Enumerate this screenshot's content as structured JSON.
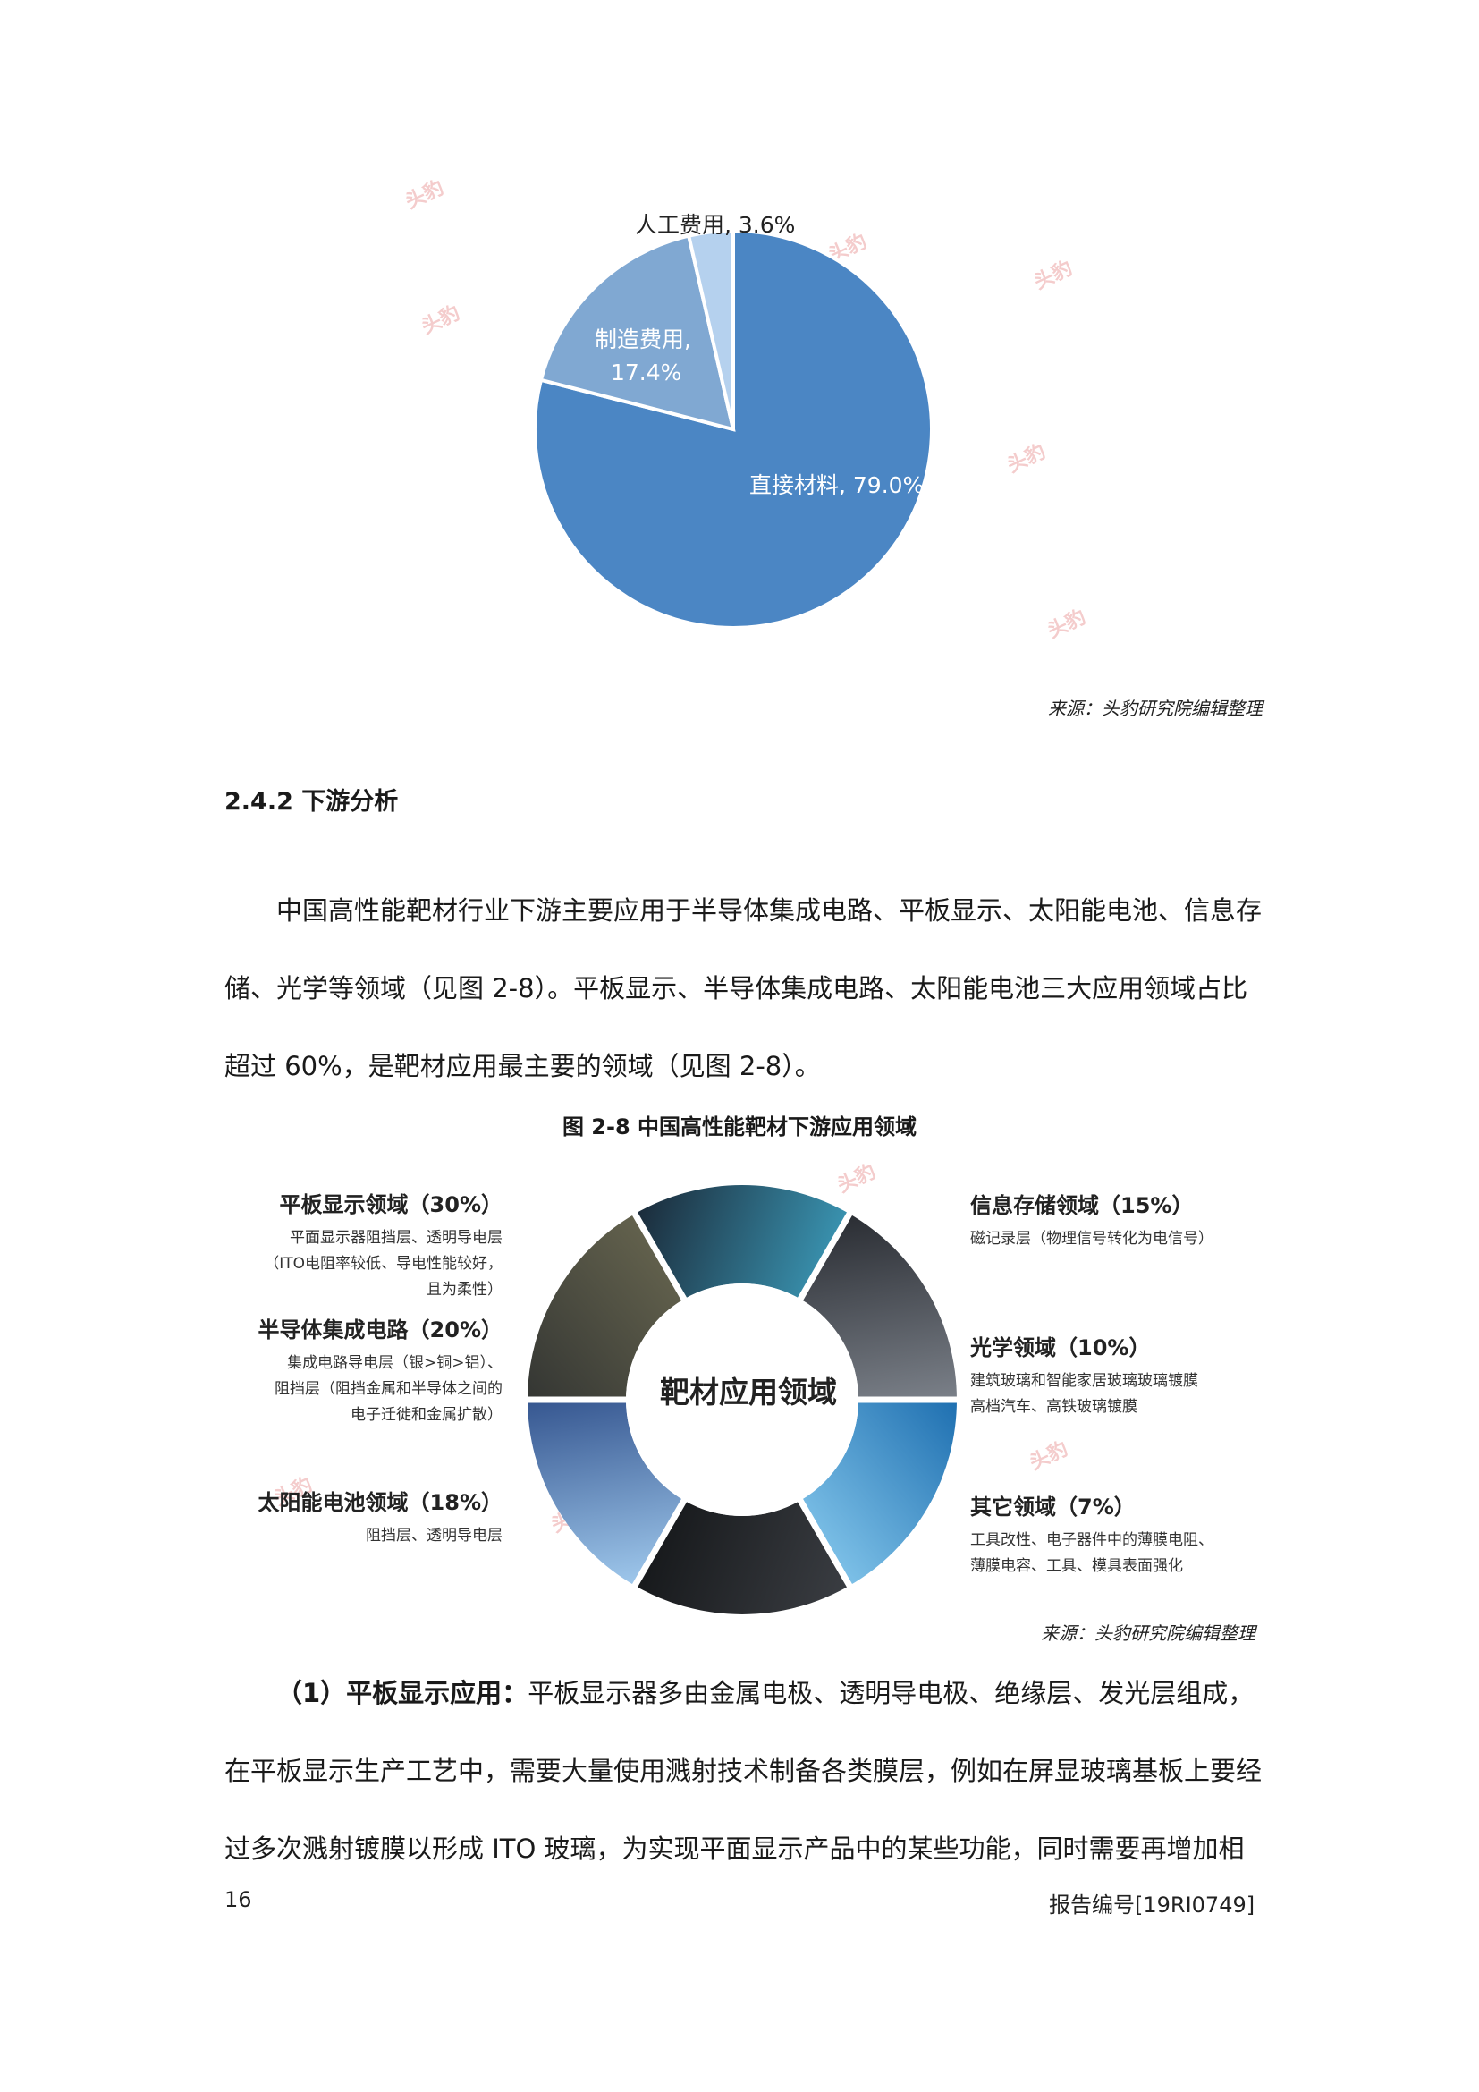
{
  "chart_data": {
    "type": "pie",
    "labels": [
      "直接材料",
      "制造费用",
      "人工费用"
    ],
    "values": [
      79.0,
      17.4,
      3.6
    ],
    "label_texts": [
      "直接材料, 79.0%",
      "制造费用,",
      "17.4%",
      "人工费用, 3.6%"
    ],
    "colors": [
      "#4b86c4",
      "#80a8d2",
      "#b5d1ee"
    ]
  },
  "figure1_source": "来源：头豹研究院编辑整理",
  "section_heading": "2.4.2 下游分析",
  "paragraph1": [
    "中国高性能靶材行业下游主要应用于半导体集成电路、平板显示、太阳能电池、信息存",
    "储、光学等领域（见图 2-8）。平板显示、半导体集成电路、太阳能电池三大应用领域占比",
    "超过 60%，是靶材应用最主要的领域（见图 2-8）。"
  ],
  "figure2": {
    "caption": "图 2-8  中国高性能靶材下游应用领域",
    "center": "靶材应用领域",
    "segments": [
      {
        "title": "平板显示领域（30%）",
        "lines": [
          "平面显示器阻挡层、透明导电层",
          "（ITO电阻率较低、导电性能较好，",
          "且为柔性）"
        ]
      },
      {
        "title": "半导体集成电路（20%）",
        "lines": [
          "集成电路导电层（银>铜>铝）、",
          "阻挡层（阻挡金属和半导体之间的",
          "电子迁徙和金属扩散）"
        ]
      },
      {
        "title": "太阳能电池领域（18%）",
        "lines": [
          "阻挡层、透明导电层"
        ]
      },
      {
        "title": "信息存储领域（15%）",
        "lines": [
          "磁记录层（物理信号转化为电信号）"
        ]
      },
      {
        "title": "光学领域（10%）",
        "lines": [
          "建筑玻璃和智能家居玻璃玻璃镀膜",
          "高档汽车、高铁玻璃镀膜"
        ]
      },
      {
        "title": "其它领域（7%）",
        "lines": [
          "工具改性、电子器件中的薄膜电阻、",
          "薄膜电容、工具、模具表面强化"
        ]
      }
    ],
    "source": "来源：头豹研究院编辑整理"
  },
  "paragraph2": {
    "lead": "（1）平板显示应用：",
    "line1": "平板显示器多由金属电极、透明导电极、绝缘层、发光层组成，",
    "line2": "在平板显示生产工艺中，需要大量使用溅射技术制备各类膜层，例如在屏显玻璃基板上要经",
    "line3": "过多次溅射镀膜以形成 ITO 玻璃，为实现平面显示产品中的某些功能，同时需要再增加相"
  },
  "footer": {
    "page_number": "16",
    "report_number": "报告编号[19RI0749]"
  },
  "watermark": "头豹"
}
